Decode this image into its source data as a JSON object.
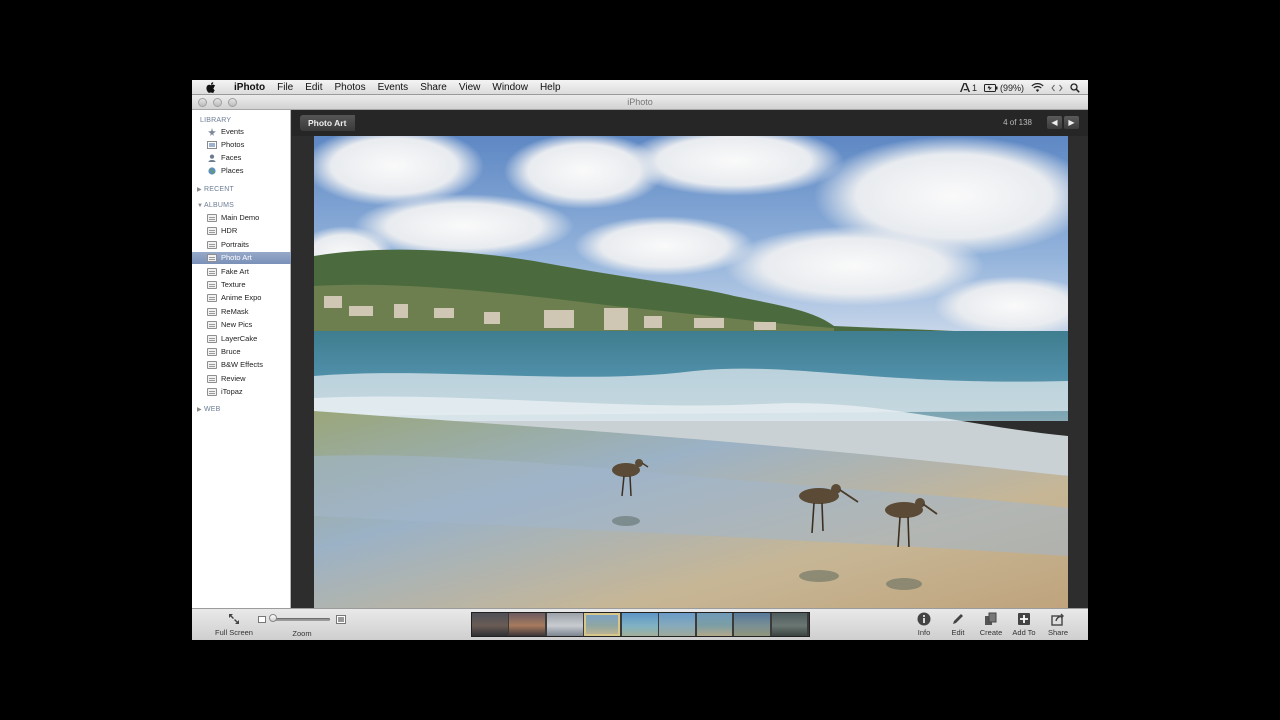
{
  "menubar": {
    "apple_icon": "apple-icon",
    "app_name": "iPhoto",
    "menus": [
      "File",
      "Edit",
      "Photos",
      "Events",
      "Share",
      "View",
      "Window",
      "Help"
    ],
    "status": {
      "adobe_count": "1",
      "battery": "(99%)",
      "wifi_icon": "wifi-icon",
      "code_icon": "code-icon",
      "search_icon": "search-icon"
    }
  },
  "window": {
    "title": "iPhoto"
  },
  "sidebar": {
    "library_header": "LIBRARY",
    "library_items": [
      {
        "label": "Events",
        "icon": "events-icon"
      },
      {
        "label": "Photos",
        "icon": "photos-icon"
      },
      {
        "label": "Faces",
        "icon": "faces-icon"
      },
      {
        "label": "Places",
        "icon": "places-icon"
      }
    ],
    "recent_header": "RECENT",
    "albums_header": "ALBUMS",
    "albums": [
      "Main Demo",
      "HDR",
      "Portraits",
      "Photo Art",
      "Fake Art",
      "Texture",
      "Anime Expo",
      "ReMask",
      "New Pics",
      "LayerCake",
      "Bruce",
      "B&W Effects",
      "Review",
      "iTopaz"
    ],
    "selected_album": "Photo Art",
    "web_header": "WEB"
  },
  "viewer": {
    "album_title": "Photo Art",
    "counter": "4 of 138",
    "prev_icon": "arrow-left-icon",
    "next_icon": "arrow-right-icon",
    "photo_subject": "beach-shorebirds-photo"
  },
  "toolbar": {
    "fullscreen_label": "Full Screen",
    "zoom_label": "Zoom",
    "zoom_level": 0.05,
    "filmstrip_count": 9,
    "filmstrip_current_index": 3,
    "info_label": "Info",
    "edit_label": "Edit",
    "create_label": "Create",
    "addto_label": "Add To",
    "share_label": "Share"
  },
  "colors": {
    "selection": "#7a90b8",
    "sidebar_header": "#6c7d95",
    "viewer_bg": "#2d2d2d",
    "current_thumb_outline": "#d7c78a"
  }
}
